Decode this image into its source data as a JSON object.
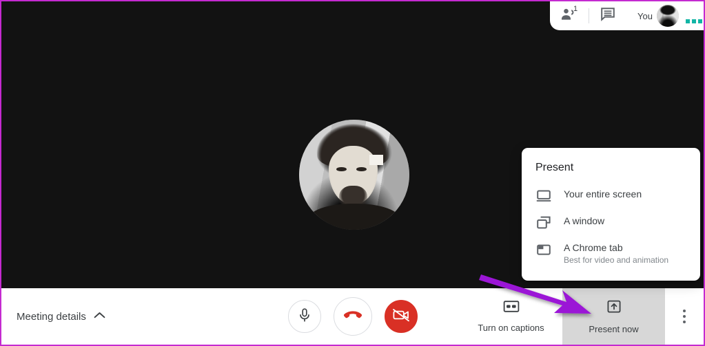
{
  "app": {
    "name": "Google Meet",
    "stage_background": "#121212",
    "annotation_arrow_color": "#9b18d6",
    "screenshot_border_color": "#c42ad0",
    "accent_red": "#d93025",
    "active_cell_background": "#d7d7d7"
  },
  "top_bar": {
    "participants": {
      "icon": "people-icon",
      "count": "1"
    },
    "chat": {
      "icon": "chat-icon"
    },
    "self": {
      "label": "You",
      "avatar": "user-avatar"
    },
    "status_dots_color": "#12b5a5"
  },
  "stage": {
    "self_view": {
      "avatar": "participant-avatar"
    }
  },
  "present_popup": {
    "title": "Present",
    "items": [
      {
        "label": "Your entire screen",
        "sub": "",
        "icon": "monitor-icon"
      },
      {
        "label": "A window",
        "sub": "",
        "icon": "windows-icon"
      },
      {
        "label": "A Chrome tab",
        "sub": "Best for video and animation",
        "icon": "browser-tab-icon"
      }
    ]
  },
  "toolbar": {
    "meeting_details": {
      "label": "Meeting details",
      "chevron": "chevron-up-icon"
    },
    "controls": [
      {
        "name": "microphone",
        "icon": "mic-icon",
        "state": "on"
      },
      {
        "name": "hang-up",
        "icon": "call-end-icon",
        "state": "default"
      },
      {
        "name": "camera",
        "icon": "video-off-icon",
        "state": "off"
      }
    ],
    "captions": {
      "label": "Turn on captions",
      "icon": "closed-caption-icon"
    },
    "present": {
      "label": "Present now",
      "icon": "present-upload-icon",
      "highlighted": true
    },
    "more_options": {
      "icon": "more-vert-icon"
    }
  }
}
